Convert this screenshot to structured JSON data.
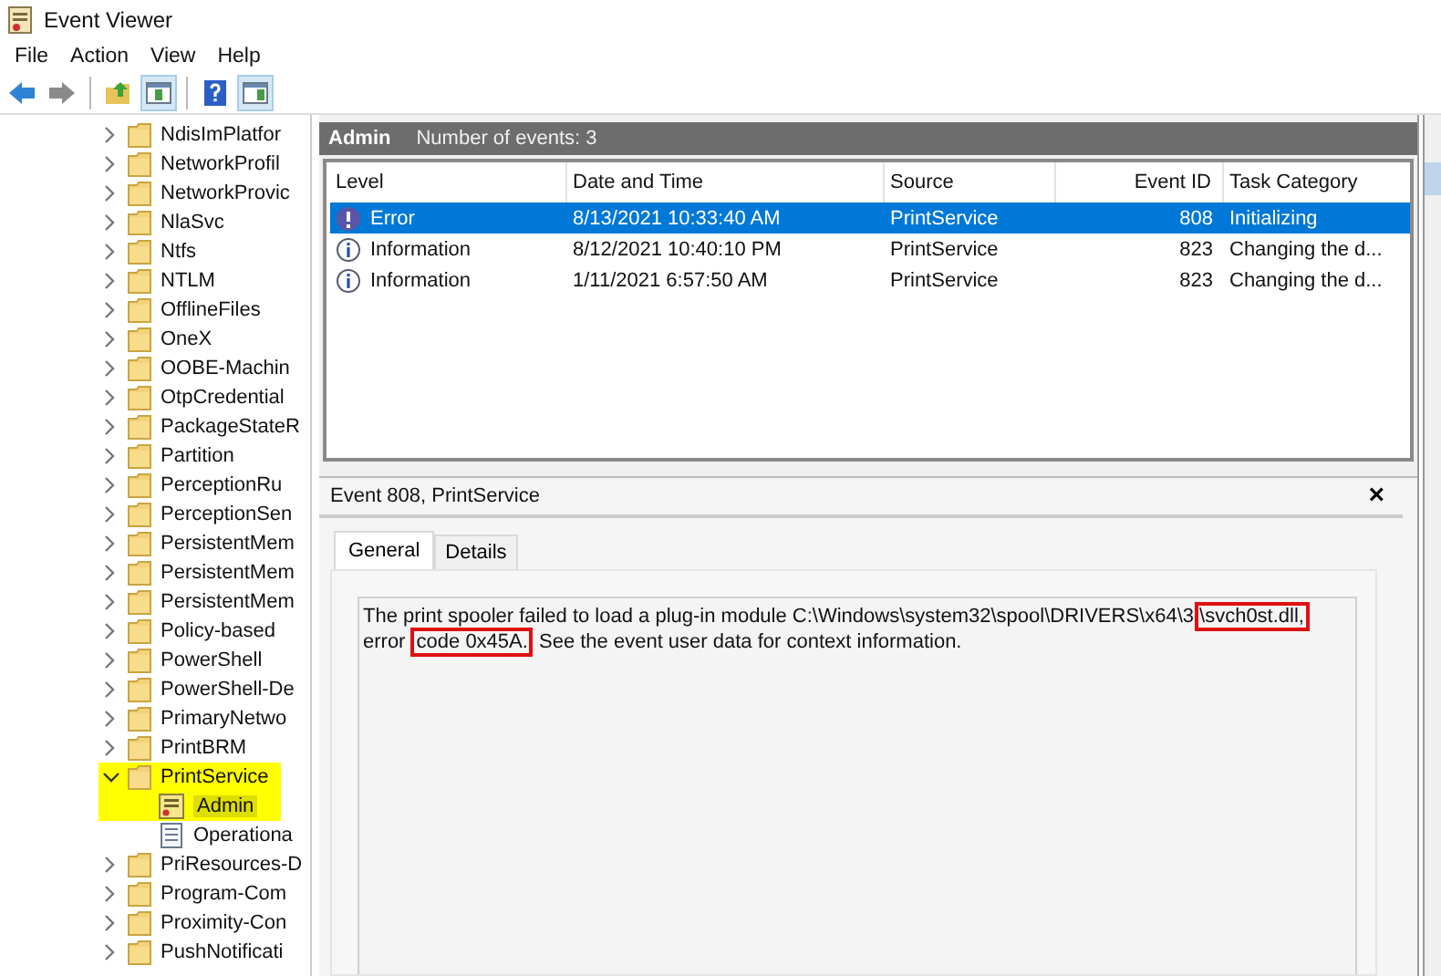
{
  "window": {
    "title": "Event Viewer"
  },
  "menu": [
    "File",
    "Action",
    "View",
    "Help"
  ],
  "toolbar": [
    {
      "kind": "back",
      "selected": false
    },
    {
      "kind": "forward",
      "selected": false
    },
    {
      "kind": "sep"
    },
    {
      "kind": "up",
      "selected": false
    },
    {
      "kind": "tree",
      "selected": true
    },
    {
      "kind": "sep"
    },
    {
      "kind": "help",
      "selected": false
    },
    {
      "kind": "actions",
      "selected": true
    }
  ],
  "tree": {
    "items": [
      {
        "label": "NdisImPlatfor",
        "expanded": false,
        "highlighted": false
      },
      {
        "label": "NetworkProfil",
        "expanded": false,
        "highlighted": false
      },
      {
        "label": "NetworkProvic",
        "expanded": false,
        "highlighted": false
      },
      {
        "label": "NlaSvc",
        "expanded": false,
        "highlighted": false
      },
      {
        "label": "Ntfs",
        "expanded": false,
        "highlighted": false
      },
      {
        "label": "NTLM",
        "expanded": false,
        "highlighted": false
      },
      {
        "label": "OfflineFiles",
        "expanded": false,
        "highlighted": false
      },
      {
        "label": "OneX",
        "expanded": false,
        "highlighted": false
      },
      {
        "label": "OOBE-Machin",
        "expanded": false,
        "highlighted": false
      },
      {
        "label": "OtpCredential",
        "expanded": false,
        "highlighted": false
      },
      {
        "label": "PackageStateR",
        "expanded": false,
        "highlighted": false
      },
      {
        "label": "Partition",
        "expanded": false,
        "highlighted": false
      },
      {
        "label": "PerceptionRu",
        "expanded": false,
        "highlighted": false
      },
      {
        "label": "PerceptionSen",
        "expanded": false,
        "highlighted": false
      },
      {
        "label": "PersistentMem",
        "expanded": false,
        "highlighted": false
      },
      {
        "label": "PersistentMem",
        "expanded": false,
        "highlighted": false
      },
      {
        "label": "PersistentMem",
        "expanded": false,
        "highlighted": false
      },
      {
        "label": "Policy-based",
        "expanded": false,
        "highlighted": false
      },
      {
        "label": "PowerShell",
        "expanded": false,
        "highlighted": false
      },
      {
        "label": "PowerShell-De",
        "expanded": false,
        "highlighted": false
      },
      {
        "label": "PrimaryNetwo",
        "expanded": false,
        "highlighted": false
      },
      {
        "label": "PrintBRM",
        "expanded": false,
        "highlighted": false
      },
      {
        "label": "PrintService",
        "expanded": true,
        "highlighted": true,
        "children": [
          {
            "label": "Admin",
            "kind": "admin",
            "selected": true,
            "highlighted": true
          },
          {
            "label": "Operationa",
            "kind": "log",
            "selected": false,
            "highlighted": false
          }
        ]
      },
      {
        "label": "PriResources-D",
        "expanded": false,
        "highlighted": false
      },
      {
        "label": "Program-Com",
        "expanded": false,
        "highlighted": false
      },
      {
        "label": "Proximity-Con",
        "expanded": false,
        "highlighted": false
      },
      {
        "label": "PushNotificati",
        "expanded": false,
        "highlighted": false
      }
    ]
  },
  "log_header": {
    "title": "Admin",
    "count": "Number of events: 3"
  },
  "table": {
    "columns": [
      "Level",
      "Date and Time",
      "Source",
      "Event ID",
      "Task Category"
    ],
    "rows": [
      {
        "kind": "error",
        "level": "Error",
        "date": "8/13/2021 10:33:40 AM",
        "source": "PrintService",
        "event_id": "808",
        "category": "Initializing",
        "selected": true
      },
      {
        "kind": "info",
        "level": "Information",
        "date": "8/12/2021 10:40:10 PM",
        "source": "PrintService",
        "event_id": "823",
        "category": "Changing the d...",
        "selected": false
      },
      {
        "kind": "info",
        "level": "Information",
        "date": "1/11/2021 6:57:50 AM",
        "source": "PrintService",
        "event_id": "823",
        "category": "Changing the d...",
        "selected": false
      }
    ]
  },
  "detail": {
    "title": "Event 808, PrintService",
    "close": "×",
    "tabs": [
      {
        "label": "General",
        "selected": true
      },
      {
        "label": "Details",
        "selected": false
      }
    ],
    "message": [
      {
        "text": "The print spooler failed to load a plug-in module C:\\Windows\\system32\\spool\\DRIVERS\\x64\\3",
        "boxed": false
      },
      {
        "text": "\\svch0st.dll,",
        "boxed": true
      },
      {
        "text": " error ",
        "boxed": false
      },
      {
        "text": "code 0x45A.",
        "boxed": true
      },
      {
        "text": " See the event user data for context information.",
        "boxed": false
      }
    ]
  }
}
